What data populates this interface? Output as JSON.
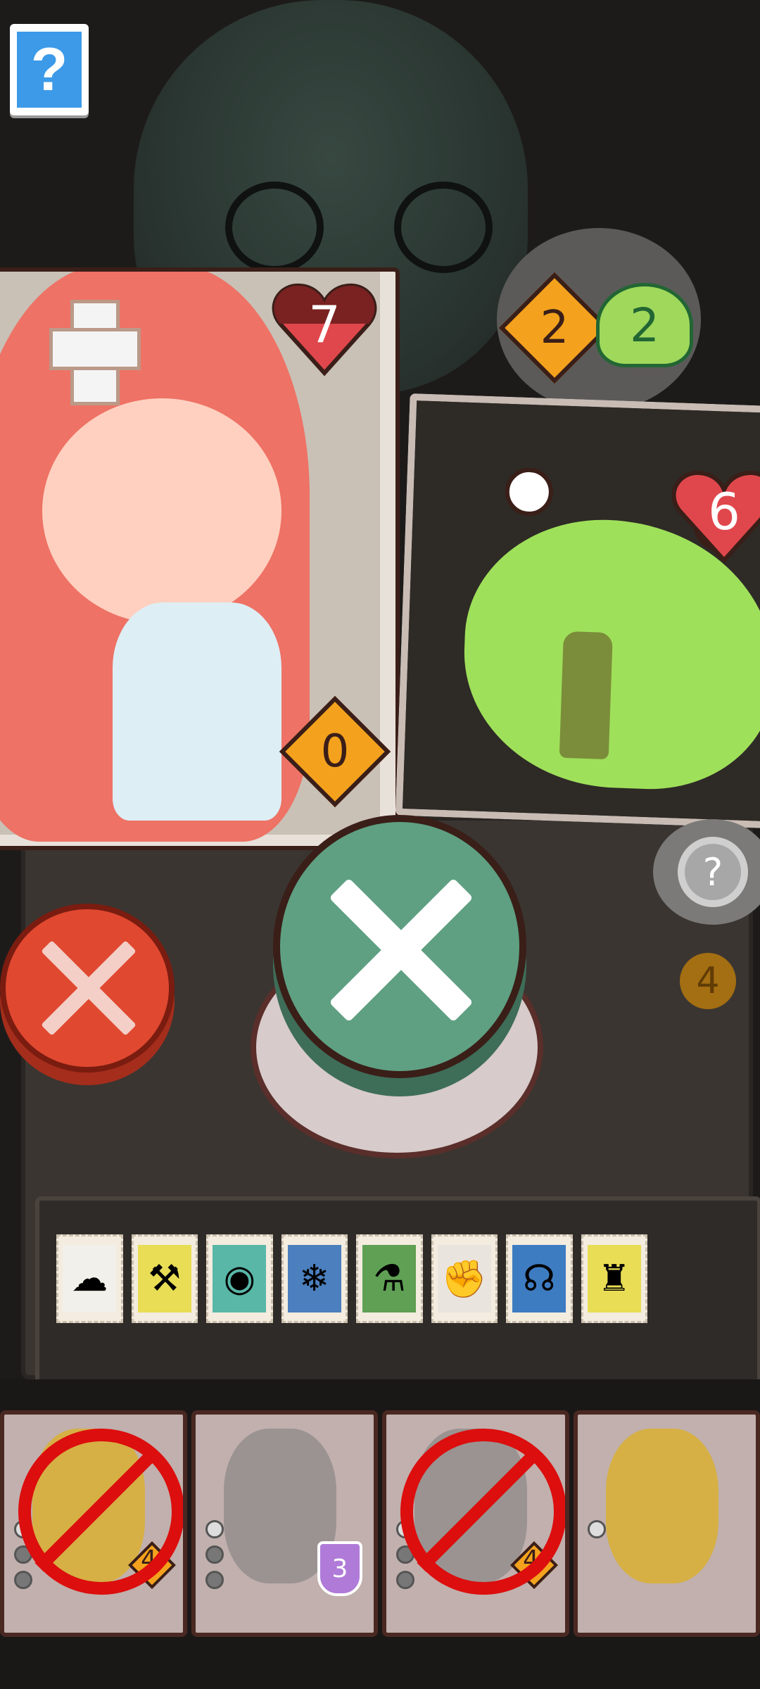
{
  "help": {
    "label": "?"
  },
  "hero": {
    "health": "7",
    "armor": "0",
    "colors": {
      "heart_top": "#7a2121",
      "heart_bottom": "#e0474c"
    }
  },
  "enemy": {
    "health": "6",
    "intent": {
      "damage": "2",
      "poison": "2"
    },
    "colors": {
      "heart": "#e0474c",
      "slime": "#9fe05a"
    }
  },
  "inspect": {
    "label": "?"
  },
  "board_token": "4",
  "stamps": [
    {
      "icon": "angel-ghost-icon",
      "color": "#f2f0ea"
    },
    {
      "icon": "scythe-icon",
      "color": "#e8dd55"
    },
    {
      "icon": "eye-icon",
      "color": "#59b7a8"
    },
    {
      "icon": "snowflake-icon",
      "color": "#4b7fbd"
    },
    {
      "icon": "potion-icon",
      "color": "#5fa054"
    },
    {
      "icon": "muscle-icon",
      "color": "#e9e4de"
    },
    {
      "icon": "brain-icon",
      "color": "#3e7cc2"
    },
    {
      "icon": "top-hat-icon",
      "color": "#e8dd55"
    }
  ],
  "hand": [
    {
      "name": "hammer-card",
      "cost": "4",
      "banned": true,
      "pips": 3
    },
    {
      "name": "hat-card",
      "shield": "3",
      "banned": false,
      "pips": 3
    },
    {
      "name": "mace-card",
      "cost": "4",
      "banned": true,
      "pips": 3
    },
    {
      "name": "mask-card",
      "banned": false,
      "pips": 1
    }
  ]
}
